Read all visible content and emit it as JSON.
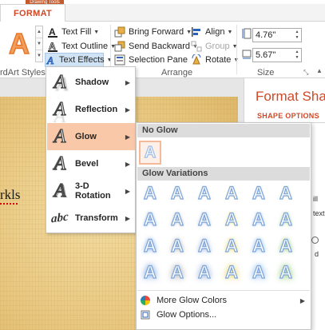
{
  "ribbon": {
    "contextual_label": "Drawing Tools",
    "format_tab": "FORMAT",
    "wordart": {
      "sample_glyph": "A",
      "group_label": "rdArt Styles",
      "text_fill": "Text Fill",
      "text_outline": "Text Outline",
      "text_effects": "Text Effects"
    },
    "arrange": {
      "bring_forward": "Bring Forward",
      "send_backward": "Send Backward",
      "selection_pane": "Selection Pane",
      "align": "Align",
      "group": "Group",
      "rotate": "Rotate",
      "group_label": "Arrange"
    },
    "size": {
      "height": "4.76\"",
      "width": "5.67\"",
      "group_label": "Size"
    }
  },
  "document": {
    "slide_text": "rkls"
  },
  "format_pane": {
    "title": "Format Shap",
    "tab": "SHAPE OPTIONS",
    "frag_1": "ill",
    "frag_2": "text",
    "frag_3": "d"
  },
  "text_effects_menu": {
    "items": [
      {
        "label": "Shadow",
        "glyph": "A"
      },
      {
        "label": "Reflection",
        "glyph": "A"
      },
      {
        "label": "Glow",
        "glyph": "A"
      },
      {
        "label": "Bevel",
        "glyph": "A"
      },
      {
        "label": "3-D Rotation",
        "glyph": "A"
      },
      {
        "label": "Transform",
        "glyph": "abc"
      }
    ],
    "selected": "Glow"
  },
  "glow_submenu": {
    "no_glow_header": "No Glow",
    "variations_header": "Glow Variations",
    "swatch_glyph": "A",
    "glow_colors": [
      "#6e9fe0",
      "#a7a7a7",
      "#8ea9d8",
      "#e6d45a",
      "#7fb4ea",
      "#8cc46c"
    ],
    "more_colors": "More Glow Colors",
    "options": "Glow Options..."
  }
}
